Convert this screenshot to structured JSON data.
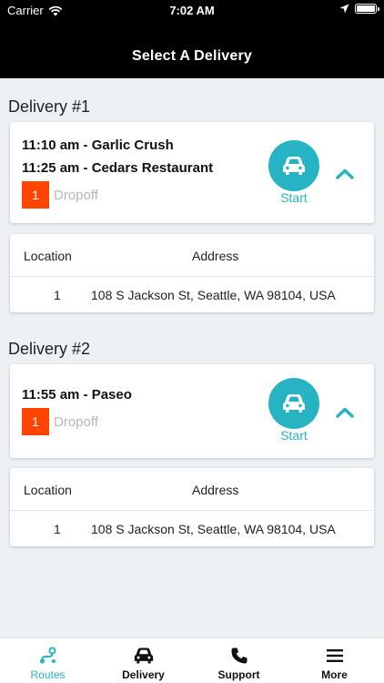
{
  "status_bar": {
    "carrier": "Carrier",
    "time": "7:02 AM"
  },
  "header": {
    "title": "Select A Delivery"
  },
  "accent_color": "#26b4c4",
  "badge_color": "#ff4500",
  "deliveries": [
    {
      "heading": "Delivery #1",
      "stops": [
        "11:10 am - Garlic Crush",
        "11:25 am - Cedars Restaurant"
      ],
      "badge": "1",
      "status": "Dropoff",
      "start_label": "Start",
      "table": {
        "headers": {
          "location": "Location",
          "address": "Address"
        },
        "rows": [
          {
            "location": "1",
            "address": "108 S Jackson St, Seattle, WA 98104, USA"
          }
        ]
      }
    },
    {
      "heading": "Delivery #2",
      "stops": [
        "11:55 am - Paseo"
      ],
      "badge": "1",
      "status": "Dropoff",
      "start_label": "Start",
      "table": {
        "headers": {
          "location": "Location",
          "address": "Address"
        },
        "rows": [
          {
            "location": "1",
            "address": "108 S Jackson St, Seattle, WA 98104, USA"
          }
        ]
      }
    }
  ],
  "tabs": [
    {
      "label": "Routes",
      "icon": "route-icon",
      "active": true
    },
    {
      "label": "Delivery",
      "icon": "car-icon",
      "active": false
    },
    {
      "label": "Support",
      "icon": "phone-icon",
      "active": false
    },
    {
      "label": "More",
      "icon": "menu-icon",
      "active": false
    }
  ]
}
